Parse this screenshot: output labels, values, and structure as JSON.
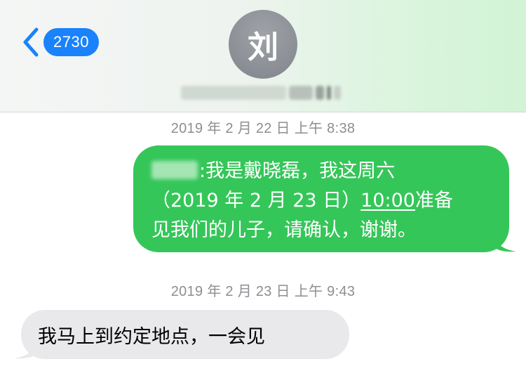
{
  "header": {
    "back_badge_count": "2730",
    "avatar_initial": "刘"
  },
  "messages": [
    {
      "timestamp": "2019 年 2 月 22 日  上午 8:38",
      "direction": "outgoing",
      "lines": [
        ":我是戴晓磊，我这周六",
        "（2019 年 2 月 23 日）",
        "10:00",
        "准备",
        "见我们的儿子，请确认，谢谢。"
      ]
    },
    {
      "timestamp": "2019 年 2 月 23 日  上午 9:43",
      "direction": "incoming",
      "text": "我马上到约定地点，一会见"
    }
  ],
  "colors": {
    "accent_blue": "#1a82fb",
    "outgoing_bubble": "#35c659",
    "incoming_bubble": "#e9e9eb",
    "avatar_gray": "#8a8e94",
    "timestamp_gray": "#8e8e93"
  },
  "icons": {
    "back": "chevron-left-icon"
  }
}
